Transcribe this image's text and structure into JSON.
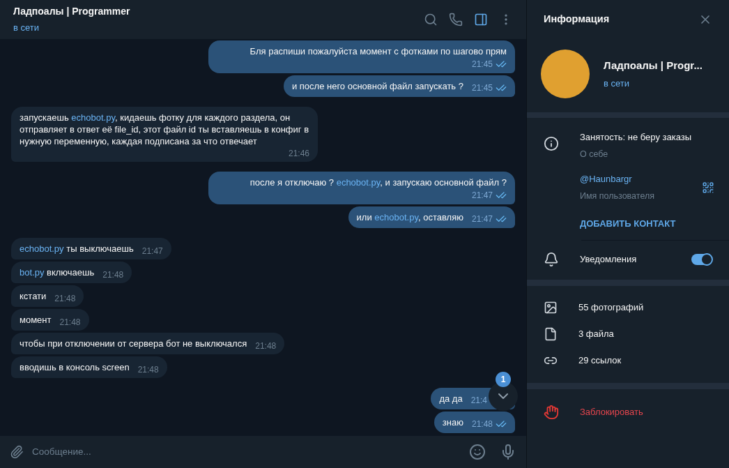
{
  "chat": {
    "title": "Ладпоалы | Programmer",
    "status": "в сети",
    "info_toggle": {
      "selected": true
    },
    "messages": [
      {
        "kind": "outgoing",
        "parts": [
          {
            "kind": "text",
            "text": "Бля распиши пожалуйста момент с фотками по шагово прям"
          }
        ],
        "time": "21:45",
        "read": true
      },
      {
        "kind": "outgoing",
        "parts": [
          {
            "kind": "text",
            "text": "и после него основной файл запускать ?"
          }
        ],
        "time": "21:45",
        "read": true
      },
      {
        "kind": "incoming",
        "parts": [
          {
            "kind": "text",
            "text": "запускаешь "
          },
          {
            "kind": "link",
            "text": "echobot.py"
          },
          {
            "kind": "text",
            "text": ", кидаешь фотку для каждого раздела, он отправляет в ответ её file_id, этот файл id ты вставляешь в конфиг в нужную переменную, каждая подписана за что отвечает"
          }
        ],
        "time": "21:46"
      },
      {
        "kind": "outgoing",
        "parts": [
          {
            "kind": "text",
            "text": "после я отключаю ? "
          },
          {
            "kind": "link",
            "text": "echobot.py"
          },
          {
            "kind": "text",
            "text": ", и запускаю основной файл ?"
          }
        ],
        "time": "21:47",
        "read": true
      },
      {
        "kind": "outgoing",
        "parts": [
          {
            "kind": "text",
            "text": "или "
          },
          {
            "kind": "link",
            "text": "echobot.py"
          },
          {
            "kind": "text",
            "text": ", оставляю"
          }
        ],
        "time": "21:47",
        "read": true
      },
      {
        "kind": "incoming",
        "parts": [
          {
            "kind": "link",
            "text": "echobot.py"
          },
          {
            "kind": "text",
            "text": " ты выключаешь"
          }
        ],
        "time": "21:47"
      },
      {
        "kind": "incoming",
        "parts": [
          {
            "kind": "link",
            "text": "bot.py"
          },
          {
            "kind": "text",
            "text": " включаешь"
          }
        ],
        "time": "21:48"
      },
      {
        "kind": "incoming",
        "parts": [
          {
            "kind": "text",
            "text": "кстати"
          }
        ],
        "time": "21:48"
      },
      {
        "kind": "incoming",
        "parts": [
          {
            "kind": "text",
            "text": "момент"
          }
        ],
        "time": "21:48"
      },
      {
        "kind": "incoming",
        "parts": [
          {
            "kind": "text",
            "text": "чтобы при отключении от сервера бот не выключался"
          }
        ],
        "time": "21:48"
      },
      {
        "kind": "incoming",
        "parts": [
          {
            "kind": "text",
            "text": "вводишь в консоль screen"
          }
        ],
        "time": "21:48"
      },
      {
        "kind": "outgoing",
        "parts": [
          {
            "kind": "text",
            "text": "да да"
          }
        ],
        "time": "21:4"
      },
      {
        "kind": "outgoing",
        "parts": [
          {
            "kind": "text",
            "text": "знаю"
          }
        ],
        "time": "21:48",
        "read": true
      }
    ],
    "unread_badge": "1",
    "composer": {
      "placeholder": "Сообщение..."
    }
  },
  "info": {
    "title": "Информация",
    "name": "Ладпоалы | Progr...",
    "status": "в сети",
    "bio": {
      "value": "Занятость: не беру заказы",
      "label": "О себе"
    },
    "username": {
      "value": "@Haunbargr",
      "label": "Имя пользователя"
    },
    "add_contact": "ДОБАВИТЬ КОНТАКТ",
    "notifications": {
      "label": "Уведомления",
      "on": true
    },
    "media": [
      {
        "kind": "photo",
        "label": "55 фотографий"
      },
      {
        "kind": "file",
        "label": "3 файла"
      },
      {
        "kind": "link",
        "label": "29 ссылок"
      }
    ],
    "block": "Заблокировать"
  }
}
